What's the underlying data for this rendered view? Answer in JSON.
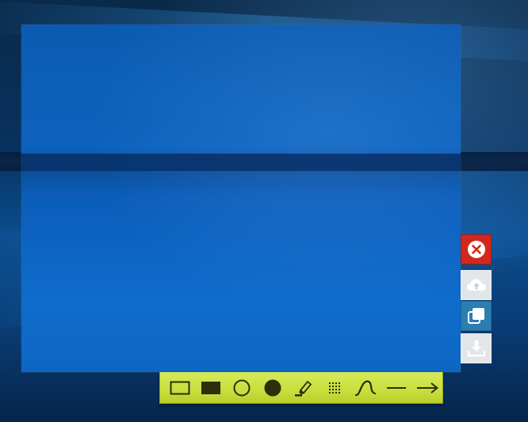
{
  "screen": {
    "wallpaper": "windows-10-hero-blue",
    "colors": {
      "toolbar_bg": "#c7df3c",
      "toolbar_icon": "#2b2f0a",
      "close_bg": "#d4271b",
      "copy_bg": "#2c7eb1",
      "neutral_btn_bg": "#e3e6e8"
    }
  },
  "side_actions": [
    {
      "id": "close",
      "icon": "close-icon"
    },
    {
      "id": "upload",
      "icon": "cloud-upload-icon"
    },
    {
      "id": "copy",
      "icon": "copy-icon"
    },
    {
      "id": "save",
      "icon": "download-icon"
    }
  ],
  "tools": [
    {
      "id": "rectangle",
      "icon": "rectangle-outline-icon"
    },
    {
      "id": "filled-rectangle",
      "icon": "rectangle-filled-icon"
    },
    {
      "id": "ellipse",
      "icon": "circle-outline-icon"
    },
    {
      "id": "filled-ellipse",
      "icon": "circle-filled-icon"
    },
    {
      "id": "highlighter",
      "icon": "marker-icon"
    },
    {
      "id": "blur",
      "icon": "pixelate-icon"
    },
    {
      "id": "freehand",
      "icon": "freehand-curve-icon"
    },
    {
      "id": "line",
      "icon": "line-icon"
    },
    {
      "id": "arrow",
      "icon": "arrow-right-icon"
    }
  ]
}
